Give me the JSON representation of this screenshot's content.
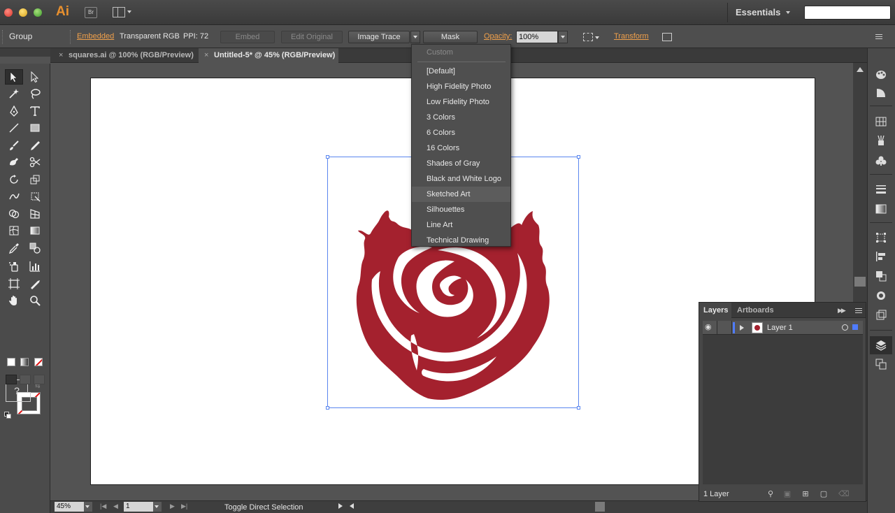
{
  "app": {
    "logo": "Ai",
    "bridge_label": "Br",
    "workspace": "Essentials"
  },
  "control_bar": {
    "selection_type": "Group",
    "embedded": "Embedded",
    "color_mode": "Transparent RGB",
    "ppi": "PPI: 72",
    "embed_label": "Embed",
    "edit_original_label": "Edit Original",
    "image_trace_label": "Image Trace",
    "mask_label": "Mask",
    "opacity_label": "Opacity:",
    "opacity_value": "100%",
    "transform_label": "Transform"
  },
  "tabs": [
    {
      "label": "squares.ai @ 100% (RGB/Preview)",
      "close": "×"
    },
    {
      "label": "Untitled-5* @ 45% (RGB/Preview)",
      "close": "×"
    }
  ],
  "toolbar": {
    "fill_unknown": "?"
  },
  "trace_menu": {
    "items": [
      "Custom",
      "[Default]",
      "High Fidelity Photo",
      "Low Fidelity Photo",
      "3 Colors",
      "6 Colors",
      "16 Colors",
      "Shades of Gray",
      "Black and White Logo",
      "Sketched Art",
      "Silhouettes",
      "Line Art",
      "Technical Drawing"
    ],
    "hovered": "Sketched Art"
  },
  "status_bar": {
    "zoom": "45%",
    "page": "1",
    "status_text": "Toggle Direct Selection"
  },
  "layers_panel": {
    "tab_layers": "Layers",
    "tab_artboards": "Artboards",
    "layer_name": "Layer 1",
    "count": "1 Layer",
    "layer_color": "#4f7cff"
  },
  "colors": {
    "rose": "#a4212e",
    "selection": "#5a86ef",
    "accent_link": "#f0a04b"
  }
}
